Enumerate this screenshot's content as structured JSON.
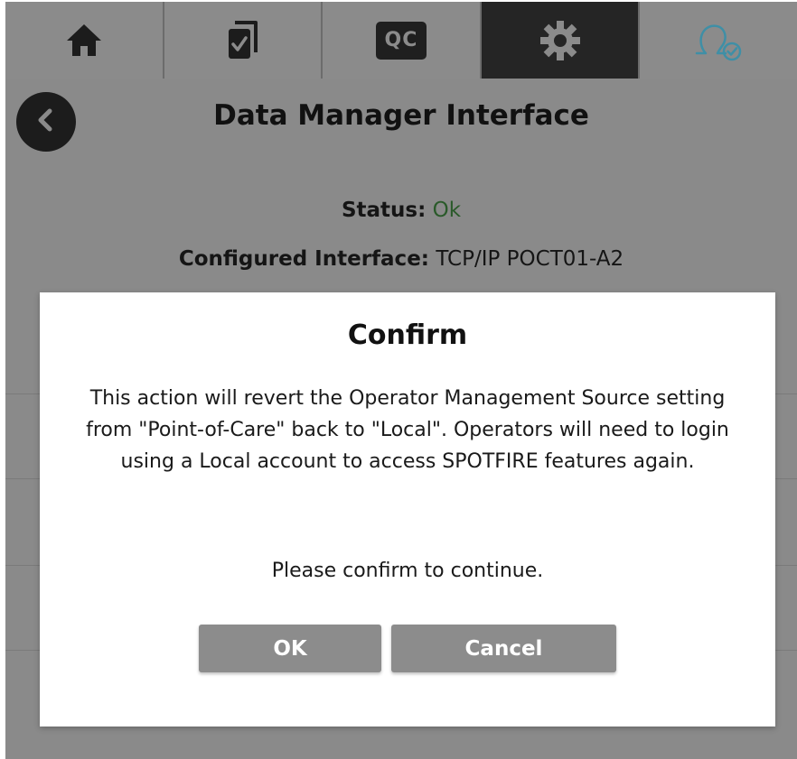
{
  "tabs": [
    {
      "name": "home",
      "icon": "home-icon",
      "active": false
    },
    {
      "name": "tasks",
      "icon": "checklist-icon",
      "active": false
    },
    {
      "name": "qc",
      "icon": "qc-icon",
      "label": "QC",
      "active": false
    },
    {
      "name": "settings",
      "icon": "gear-icon",
      "active": true
    },
    {
      "name": "operator",
      "icon": "omega-check-icon",
      "active": false
    }
  ],
  "header": {
    "title": "Data Manager Interface",
    "back_icon": "chevron-left-icon"
  },
  "status": {
    "label": "Status:",
    "value": "Ok",
    "value_color": "#2a5a2a"
  },
  "interface": {
    "label": "Configured Interface:",
    "value": "TCP/IP POCT01-A2"
  },
  "dialog": {
    "title": "Confirm",
    "message": "This action will revert the Operator Management Source setting from \"Point-of-Care\" back to \"Local\". Operators will need to login using a Local account to access SPOTFIRE features again.",
    "prompt": "Please confirm to continue.",
    "ok_label": "OK",
    "cancel_label": "Cancel"
  },
  "colors": {
    "background": "#8a8a8a",
    "active_tab": "#252525",
    "icon_teal": "#3f8fa6",
    "button": "#8c8c8c"
  }
}
